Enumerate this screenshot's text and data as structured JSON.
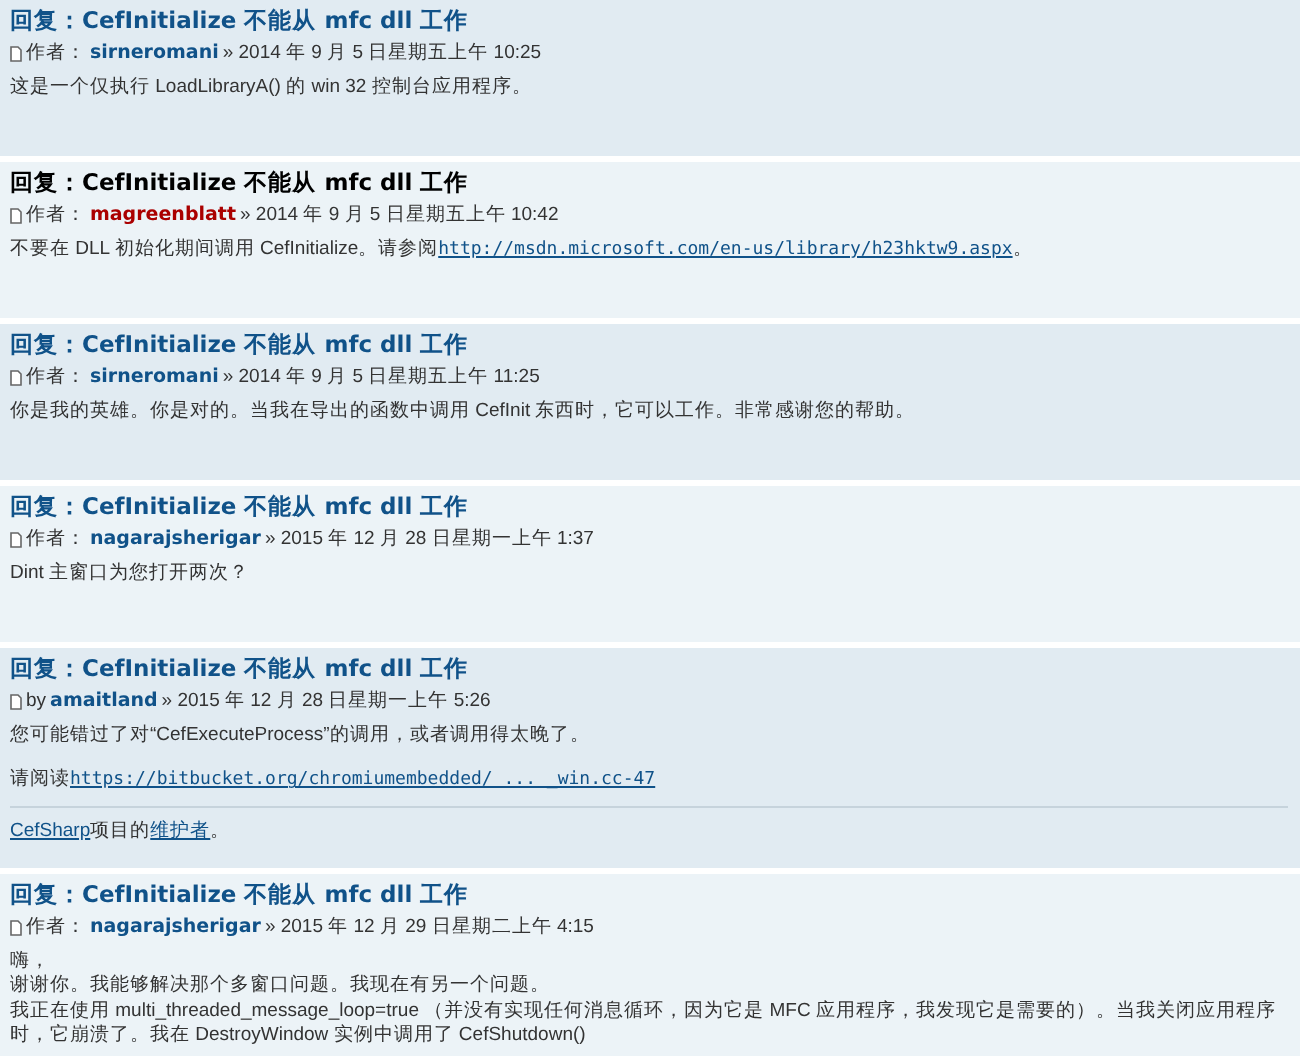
{
  "posts": [
    {
      "title": "回复：CefInitialize 不能从 mfc dll 工作",
      "by_label": "作者：",
      "author": "sirneromani",
      "moderator": false,
      "date": "» 2014 年 9 月 5 日星期五上午 10:25",
      "body": [
        [
          {
            "kind": "text",
            "text": "这是一个仅执行 LoadLibraryA() 的 win 32 控制台应用程序。"
          }
        ]
      ]
    },
    {
      "title": "回复：CefInitialize 不能从 mfc dll 工作",
      "by_label": "作者：",
      "author": "magreenblatt",
      "moderator": true,
      "date": "» 2014 年 9 月 5 日星期五上午 10:42",
      "body": [
        [
          {
            "kind": "text",
            "text": "不要在 DLL 初始化期间调用 CefInitialize。请参阅"
          },
          {
            "kind": "link",
            "text": "http://msdn.microsoft.com/en-us/library/h23hktw9.aspx"
          },
          {
            "kind": "text",
            "text": "。"
          }
        ]
      ]
    },
    {
      "title": "回复：CefInitialize 不能从 mfc dll 工作",
      "by_label": "作者：",
      "author": "sirneromani",
      "moderator": false,
      "date": "» 2014 年 9 月 5 日星期五上午 11:25",
      "body": [
        [
          {
            "kind": "text",
            "text": "你是我的英雄。你是对的。当我在导出的函数中调用 CefInit 东西时，它可以工作。非常感谢您的帮助。"
          }
        ]
      ]
    },
    {
      "title": "回复：CefInitialize 不能从 mfc dll 工作",
      "by_label": "作者：",
      "author": "nagarajsherigar",
      "moderator": false,
      "date": "» 2015 年 12 月 28 日星期一上午 1:37",
      "body": [
        [
          {
            "kind": "text",
            "text": "Dint 主窗口为您打开两次？"
          }
        ]
      ]
    },
    {
      "title": "回复：CefInitialize 不能从 mfc dll 工作",
      "by_label": "by",
      "author": "amaitland",
      "moderator": false,
      "date": "» 2015 年 12 月 28 日星期一上午 5:26",
      "body": [
        [
          {
            "kind": "text",
            "text": "您可能错过了对“CefExecuteProcess”的调用，或者调用得太晚了。"
          }
        ],
        [
          {
            "kind": "text",
            "text": "请阅读"
          },
          {
            "kind": "link",
            "text": "https://bitbucket.org/chromiumembedded/ ... _win.cc-47"
          }
        ]
      ],
      "signature": [
        {
          "kind": "link",
          "text": "CefSharp"
        },
        {
          "kind": "text",
          "text": "项目的"
        },
        {
          "kind": "link",
          "text": "维护者"
        },
        {
          "kind": "text",
          "text": "。"
        }
      ]
    },
    {
      "title": "回复：CefInitialize 不能从 mfc dll 工作",
      "by_label": "作者：",
      "author": "nagarajsherigar",
      "moderator": false,
      "date": "» 2015 年 12 月 29 日星期二上午 4:15",
      "body": [
        [
          {
            "kind": "text",
            "text": "嗨，"
          }
        ],
        [
          {
            "kind": "text",
            "text": "谢谢你。我能够解决那个多窗口问题。我现在有另一个问题。"
          }
        ],
        [
          {
            "kind": "text",
            "text": "我正在使用 multi_threaded_message_loop=true （并没有实现任何消息循环，因为它是 MFC 应用程序，我发现它是需要的）。当我关闭应用程序时，它崩溃了。我在 DestroyWindow 实例中调用了 CefShutdown()"
          }
        ]
      ]
    }
  ]
}
